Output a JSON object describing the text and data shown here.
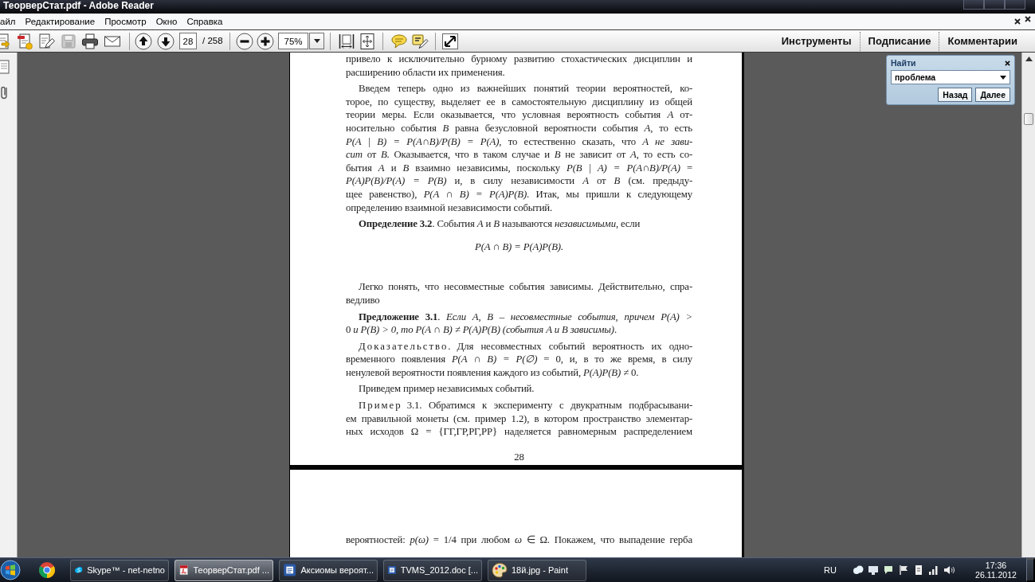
{
  "window": {
    "title": "ТеорверСтат.pdf - Adobe Reader"
  },
  "menu": [
    "айл",
    "Редактирование",
    "Просмотр",
    "Окно",
    "Справка"
  ],
  "toolbar": {
    "page": "28",
    "page_count": "/ 258",
    "zoom": "75%",
    "panes": [
      "Инструменты",
      "Подписание",
      "Комментарии"
    ]
  },
  "find_panel": {
    "title": "Найти",
    "query": "проблема",
    "buttons": [
      "Назад",
      "Далее"
    ]
  },
  "pages": [
    {
      "blocks": [
        {
          "kind": "continued",
          "lines": [
            "привело к исключительно бурному развитию стохастических дисциплин и",
            "расширению области их применения."
          ]
        },
        {
          "kind": "paragraph",
          "lines": [
            "Введем теперь одно из важнейших понятий теории вероятностей, ко-",
            "торое, по существу, выделяет ее в самостоятельную дисциплину из общей",
            "теории меры. Если оказывается, что условная вероятность события *A* от-",
            "носительно события *B* равна безусловной вероятности события *A*, то есть",
            "*P(A | B) = P(A∩B)/P(B) = P(A)*, то естественно сказать, что *A не зави-*",
            "*сит* от *B*. Оказывается, что в таком случае и *B* не зависит от *A*, то есть со-",
            "бытия *A* и *B* взаимно независимы, поскольку *P(B | A) = P(A∩B)/P(A)* =",
            "*P(A)P(B)/P(A) = P(B)* и, в силу независимости *A* от *B* (см. предыду-",
            "щее равенство), *P(A ∩ B) = P(A)P(B)*. Итак, мы пришли к следующему",
            "определению взаимной независимости событий."
          ]
        },
        {
          "kind": "paragraph",
          "lines": [
            "**Определение 3.2**. События *A* и *B* называются *независимыми*, если"
          ]
        },
        {
          "kind": "formula",
          "text": "*P(A ∩ B) = P(A)P(B).*"
        },
        {
          "kind": "paragraph",
          "lines": [
            "Легко понять, что несовместные события зависимы. Действительно, спра-",
            "ведливо"
          ]
        },
        {
          "kind": "paragraph",
          "lines": [
            "**Предложение 3.1**. *Если A, B – несовместные события, причем P(A) >*",
            "0 *и P(B) > 0, то P(A ∩ B) ≠ P(A)P(B) (события A и B зависимы)*."
          ]
        },
        {
          "kind": "paragraph",
          "lead": "Доказательство.",
          "lines": [
            "Для несовместных событий вероятность их одно-",
            "временного появления *P(A ∩ B) = P(∅)* = 0, и, в то же время, в силу",
            "ненулевой вероятности появления каждого из событий, *P(A)P(B)* ≠ 0."
          ]
        },
        {
          "kind": "paragraph",
          "lines": [
            "Приведем пример независимых событий."
          ]
        },
        {
          "kind": "paragraph",
          "lead": "Пример",
          "lines": [
            "3.1. Обратимся к эксперименту с двукратным подбрасывани-",
            "ем правильной монеты (см. пример 1.2), в котором пространство элементар-",
            "ных исходов Ω = {ГГ,ГР,РГ,РР} наделяется равномерным распределением"
          ]
        },
        {
          "kind": "page_number",
          "text": "28"
        }
      ]
    },
    {
      "blocks": [
        {
          "kind": "continued",
          "lines": [
            "вероятностей: *p(ω)* = 1/4 при любом *ω* ∈ Ω. Покажем, что выпадение герба"
          ]
        }
      ]
    }
  ],
  "taskbar": {
    "tasks": [
      {
        "label": "Skype™ - net-netno",
        "kind": "skype",
        "selected": false
      },
      {
        "label": "ТеорверСтат.pdf ...",
        "kind": "pdf",
        "selected": true
      },
      {
        "label": "Аксиомы вероят...",
        "kind": "word",
        "selected": false
      },
      {
        "label": "TVMS_2012.doc [...",
        "kind": "word",
        "selected": false
      },
      {
        "label": "18й.jpg - Paint",
        "kind": "paint",
        "selected": false
      }
    ],
    "language": "RU",
    "time": "17:36",
    "date": "26.11.2012"
  }
}
